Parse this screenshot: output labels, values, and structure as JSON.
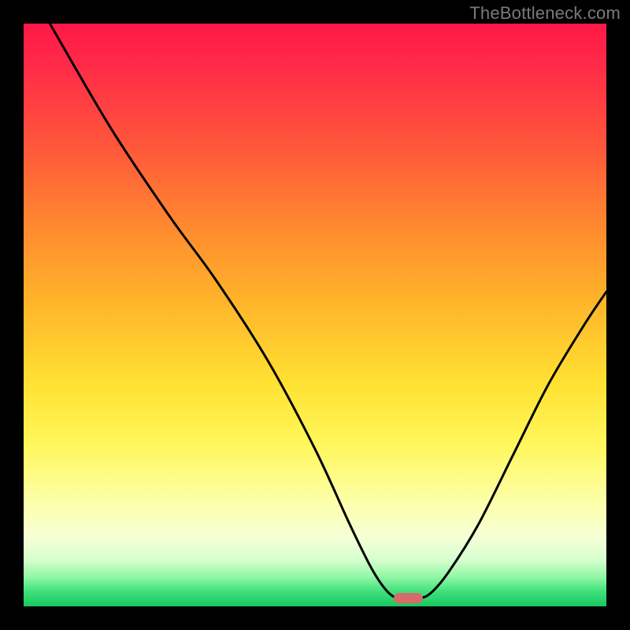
{
  "watermark": "TheBottleneck.com",
  "chart_data": {
    "type": "line",
    "title": "",
    "xlabel": "",
    "ylabel": "",
    "xlim": [
      0,
      100
    ],
    "ylim": [
      0,
      100
    ],
    "curve_points_percent": [
      [
        4.5,
        100
      ],
      [
        15,
        82
      ],
      [
        25,
        67
      ],
      [
        33,
        56
      ],
      [
        42,
        42
      ],
      [
        50,
        27
      ],
      [
        56,
        14
      ],
      [
        60,
        6
      ],
      [
        63,
        2
      ],
      [
        65.5,
        1.4
      ],
      [
        68,
        1.4
      ],
      [
        70,
        2.4
      ],
      [
        73,
        6
      ],
      [
        78,
        14
      ],
      [
        84,
        26
      ],
      [
        90,
        38
      ],
      [
        96,
        48
      ],
      [
        100,
        54
      ]
    ],
    "marker_percent": {
      "x_center": 66,
      "y_center": 1.4,
      "width": 5,
      "height": 1.8
    },
    "axis_ticks_visible": false,
    "legend": [],
    "grid": false
  }
}
